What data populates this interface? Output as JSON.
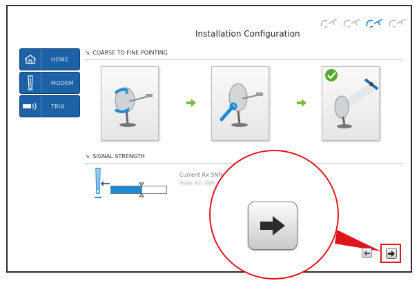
{
  "window": {
    "title": "Installation Configuration"
  },
  "progress_steps": {
    "count": 4,
    "active_index": 2,
    "icon": "satellite-signal-icon",
    "active_color": "#1d8ad6",
    "inactive_color": "#b0b0b0"
  },
  "sidebar": {
    "items": [
      {
        "label": "HOME",
        "icon": "home-icon"
      },
      {
        "label": "MODEM",
        "icon": "modem-icon"
      },
      {
        "label": "TRIA",
        "icon": "tria-icon"
      }
    ],
    "color": "#1d62a6"
  },
  "sections": {
    "pointing": {
      "marker": "↘",
      "title": "COARSE TO FINE POINTING",
      "tiles": [
        {
          "icon": "dish-adjust-icon"
        },
        {
          "icon": "dish-wrench-icon"
        },
        {
          "icon": "dish-locked-satellite-icon",
          "status": "checkmark"
        }
      ]
    },
    "signal": {
      "marker": "↘",
      "title": "SIGNAL STRENGTH",
      "level": 0.55,
      "snr_label": "Current Rx SNR:",
      "snr_value": "Peak Rx SNR:"
    }
  },
  "navigation": {
    "prev_icon": "arrow-left-icon",
    "next_icon": "arrow-right-icon"
  },
  "annotation": {
    "color": "#e1141c",
    "zoomed_icon": "arrow-right-icon"
  }
}
